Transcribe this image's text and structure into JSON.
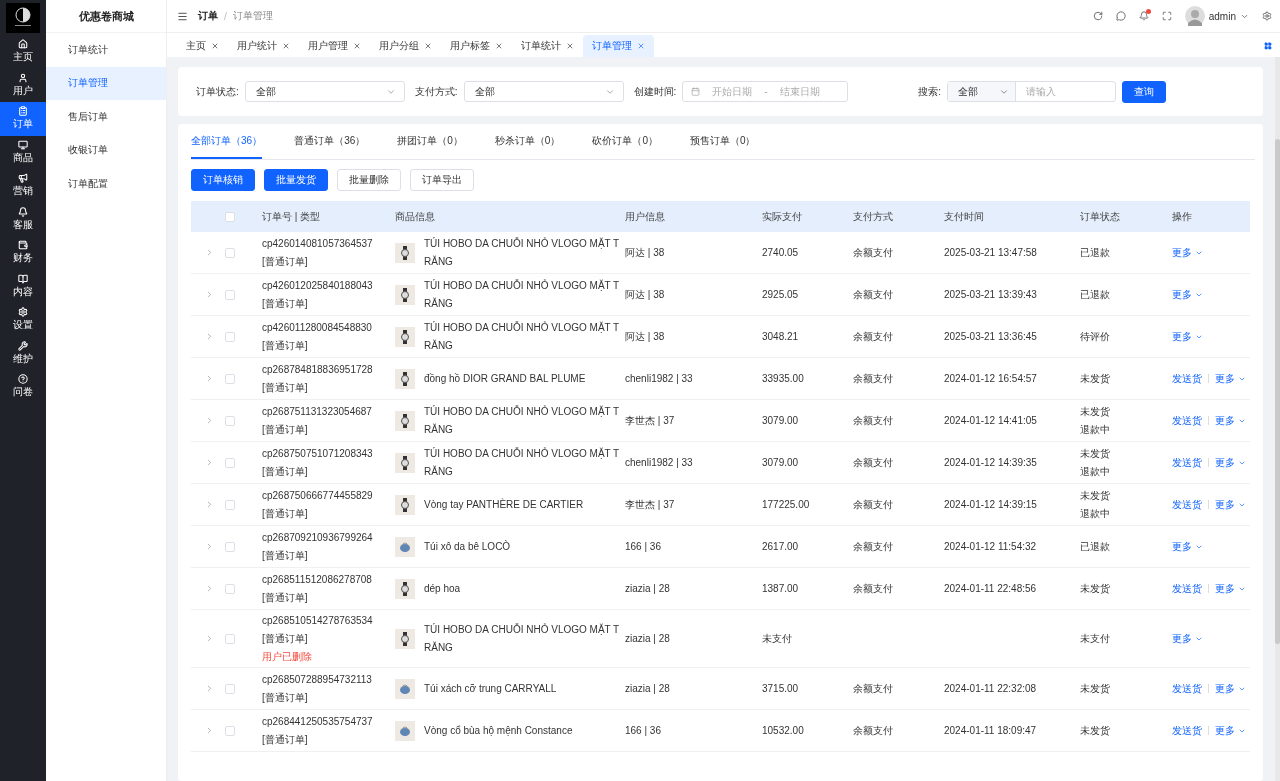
{
  "sidebar": {
    "items": [
      {
        "label": "主页",
        "selected": false
      },
      {
        "label": "用户",
        "selected": false
      },
      {
        "label": "订单",
        "selected": true
      },
      {
        "label": "商品",
        "selected": false
      },
      {
        "label": "营销",
        "selected": false
      },
      {
        "label": "客服",
        "selected": false
      },
      {
        "label": "财务",
        "selected": false
      },
      {
        "label": "内容",
        "selected": false
      },
      {
        "label": "设置",
        "selected": false
      },
      {
        "label": "维护",
        "selected": false
      },
      {
        "label": "问卷",
        "selected": false
      }
    ]
  },
  "submenu": {
    "title": "优惠卷商城",
    "items": [
      {
        "label": "订单统计",
        "selected": false
      },
      {
        "label": "订单管理",
        "selected": true
      },
      {
        "label": "售后订单",
        "selected": false
      },
      {
        "label": "收银订单",
        "selected": false
      },
      {
        "label": "订单配置",
        "selected": false
      }
    ]
  },
  "breadcrumb": [
    "订单",
    "订单管理"
  ],
  "breadcrumb_separator": "/",
  "user": {
    "name": "admin",
    "has_notification": true
  },
  "page_tabs": [
    {
      "label": "主页",
      "selected": false
    },
    {
      "label": "用户统计",
      "selected": false
    },
    {
      "label": "用户管理",
      "selected": false
    },
    {
      "label": "用户分组",
      "selected": false
    },
    {
      "label": "用户标签",
      "selected": false
    },
    {
      "label": "订单统计",
      "selected": false
    },
    {
      "label": "订单管理",
      "selected": true
    }
  ],
  "filters": {
    "status_label": "订单状态:",
    "status_value": "全部",
    "payment_label": "支付方式:",
    "payment_value": "全部",
    "date_label": "创建时间:",
    "date_start_placeholder": "开始日期",
    "date_separator": "-",
    "date_end_placeholder": "结束日期",
    "search_label": "搜索:",
    "search_scope": "全部",
    "search_placeholder": "请输入",
    "query_button": "查询"
  },
  "order_tabs": [
    {
      "label": "全部订单（36）",
      "selected": true
    },
    {
      "label": "普通订单（36）",
      "selected": false
    },
    {
      "label": "拼团订单（0）",
      "selected": false
    },
    {
      "label": "秒杀订单（0）",
      "selected": false
    },
    {
      "label": "砍价订单（0）",
      "selected": false
    },
    {
      "label": "预售订单（0）",
      "selected": false
    }
  ],
  "actions": [
    {
      "label": "订单核销",
      "kind": "primary"
    },
    {
      "label": "批量发货",
      "kind": "primary"
    },
    {
      "label": "批量删除",
      "kind": "default"
    },
    {
      "label": "订单导出",
      "kind": "default"
    }
  ],
  "table": {
    "select_all_checked": false,
    "columns": [
      "订单号 | 类型",
      "商品信息",
      "用户信息",
      "实际支付",
      "支付方式",
      "支付时间",
      "订单状态",
      "操作"
    ],
    "rows": [
      {
        "order_no": "cp426014081057364537",
        "type": "[普通订单]",
        "product": "TÚI HOBO DA CHUỖI NHỎ VLOGO MẶT TRĂNG",
        "user": "阿达 | 38",
        "paid": "2740.05",
        "method": "余额支付",
        "time": "2025-03-21 13:47:58",
        "status": [
          "已退款"
        ],
        "ship": null,
        "more": "更多",
        "checked": false
      },
      {
        "order_no": "cp426012025840188043",
        "type": "[普通订单]",
        "product": "TÚI HOBO DA CHUỖI NHỎ VLOGO MẶT TRĂNG",
        "user": "阿达 | 38",
        "paid": "2925.05",
        "method": "余额支付",
        "time": "2025-03-21 13:39:43",
        "status": [
          "已退款"
        ],
        "ship": null,
        "more": "更多",
        "checked": false
      },
      {
        "order_no": "cp426011280084548830",
        "type": "[普通订单]",
        "product": "TÚI HOBO DA CHUỖI NHỎ VLOGO MẶT TRĂNG",
        "user": "阿达 | 38",
        "paid": "3048.21",
        "method": "余额支付",
        "time": "2025-03-21 13:36:45",
        "status": [
          "待评价"
        ],
        "ship": null,
        "more": "更多",
        "checked": false
      },
      {
        "order_no": "cp268784818836951728",
        "type": "[普通订单]",
        "product": "đồng hồ DIOR GRAND BAL PLUME",
        "user": "chenli1982 | 33",
        "paid": "33935.00",
        "method": "余额支付",
        "time": "2024-01-12 16:54:57",
        "status": [
          "未发货"
        ],
        "ship": "发送货",
        "more": "更多",
        "checked": false
      },
      {
        "order_no": "cp268751131323054687",
        "type": "[普通订单]",
        "product": "TÚI HOBO DA CHUỖI NHỎ VLOGO MẶT TRĂNG",
        "user": "李世杰 | 37",
        "paid": "3079.00",
        "method": "余额支付",
        "time": "2024-01-12 14:41:05",
        "status": [
          "未发货",
          "退款中"
        ],
        "ship": "发送货",
        "more": "更多",
        "checked": false
      },
      {
        "order_no": "cp268750751071208343",
        "type": "[普通订单]",
        "product": "TÚI HOBO DA CHUỖI NHỎ VLOGO MẶT TRĂNG",
        "user": "chenli1982 | 33",
        "paid": "3079.00",
        "method": "余额支付",
        "time": "2024-01-12 14:39:35",
        "status": [
          "未发货",
          "退款中"
        ],
        "ship": "发送货",
        "more": "更多",
        "checked": false
      },
      {
        "order_no": "cp268750666774455829",
        "type": "[普通订单]",
        "product": "Vòng tay PANTHÈRE DE CARTIER",
        "user": "李世杰 | 37",
        "paid": "177225.00",
        "method": "余额支付",
        "time": "2024-01-12 14:39:15",
        "status": [
          "未发货",
          "退款中"
        ],
        "ship": "发送货",
        "more": "更多",
        "checked": false
      },
      {
        "order_no": "cp268709210936799264",
        "type": "[普通订单]",
        "product": "Túi xô da bê LOCÒ",
        "user": "166 | 36",
        "paid": "2617.00",
        "method": "余额支付",
        "time": "2024-01-12 11:54:32",
        "status": [
          "已退款"
        ],
        "ship": null,
        "more": "更多",
        "checked": false
      },
      {
        "order_no": "cp268511512086278708",
        "type": "[普通订单]",
        "product": "dép hoa",
        "user": "ziazia | 28",
        "paid": "1387.00",
        "method": "余额支付",
        "time": "2024-01-11 22:48:56",
        "status": [
          "未发货"
        ],
        "ship": "发送货",
        "more": "更多",
        "checked": false
      },
      {
        "order_no": "cp268510514278763534",
        "type": "[普通订单]",
        "note": "用户已删除",
        "product": "TÚI HOBO DA CHUỖI NHỎ VLOGO MẶT TRĂNG",
        "user": "ziazia | 28",
        "paid": "未支付",
        "status": [
          "未支付"
        ],
        "ship": null,
        "more": "更多",
        "checked": false
      },
      {
        "order_no": "cp268507288954732113",
        "type": "[普通订单]",
        "product": "Túi xách cỡ trung CARRYALL",
        "user": "ziazia | 28",
        "paid": "3715.00",
        "method": "余额支付",
        "time": "2024-01-11 22:32:08",
        "status": [
          "未发货"
        ],
        "ship": "发送货",
        "more": "更多",
        "checked": false
      },
      {
        "order_no": "cp268441250535754737",
        "type": "[普通订单]",
        "product": "Vòng cổ bùa hộ mệnh Constance",
        "user": "166 | 36",
        "paid": "10532.00",
        "method": "余额支付",
        "time": "2024-01-11 18:09:47",
        "status": [
          "未发货"
        ],
        "ship": "发送货",
        "more": "更多",
        "checked": false
      }
    ]
  }
}
